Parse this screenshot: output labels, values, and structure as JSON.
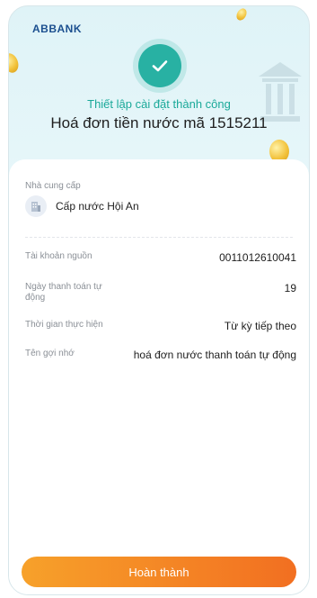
{
  "app": {
    "logo_primary": "ABBANK",
    "logo_accent": ""
  },
  "header": {
    "status_text": "Thiết lập cài đặt thành công",
    "bill_title": "Hoá đơn tiền nước mã 1515211"
  },
  "provider": {
    "label": "Nhà cung cấp",
    "name": "Cấp nước Hội An"
  },
  "details": [
    {
      "label": "Tài khoản nguồn",
      "value": "0011012610041"
    },
    {
      "label": "Ngày thanh toán tự động",
      "value": "19"
    },
    {
      "label": "Thời gian thực hiện",
      "value": "Từ kỳ tiếp theo"
    },
    {
      "label": "Tên gợi nhớ",
      "value": "hoá đơn nước thanh toán tự động"
    }
  ],
  "footer": {
    "done_button": "Hoàn thành"
  },
  "colors": {
    "accent_teal": "#28b1a3",
    "button_orange": "#f26f21",
    "button_orange_light": "#f7a12a"
  },
  "icons": {
    "success": "check-icon",
    "provider": "building-icon"
  }
}
